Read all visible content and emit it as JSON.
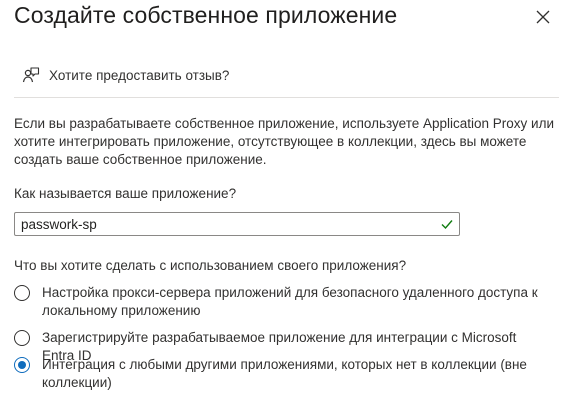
{
  "dialog": {
    "title": "Создайте собственное приложение",
    "close_icon": "close-icon"
  },
  "feedback": {
    "icon": "feedback-person-icon",
    "label": "Хотите предоставить отзыв?"
  },
  "description": "Если вы разрабатываете собственное приложение, используете Application Proxy или хотите интегрировать приложение, отсутствующее в коллекции, здесь вы можете создать ваше собственное приложение.",
  "app_name": {
    "label": "Как называется ваше приложение?",
    "value": "passwork-sp",
    "valid_icon": "checkmark-icon",
    "valid_color": "#107c10"
  },
  "purpose": {
    "label": "Что вы хотите сделать с использованием своего приложения?",
    "options": [
      {
        "label": "Настройка прокси-сервера приложений для безопасного удаленного доступа к локальному приложению",
        "selected": false
      },
      {
        "label": "Зарегистрируйте разрабатываемое приложение для интеграции с Microsoft Entra ID",
        "selected": false
      },
      {
        "label": "Интеграция с любыми другими приложениями, которых нет в коллекции (вне коллекции)",
        "selected": true
      }
    ]
  },
  "colors": {
    "accent": "#0f6cbd",
    "text": "#323130",
    "divider": "#e1dfdd"
  }
}
